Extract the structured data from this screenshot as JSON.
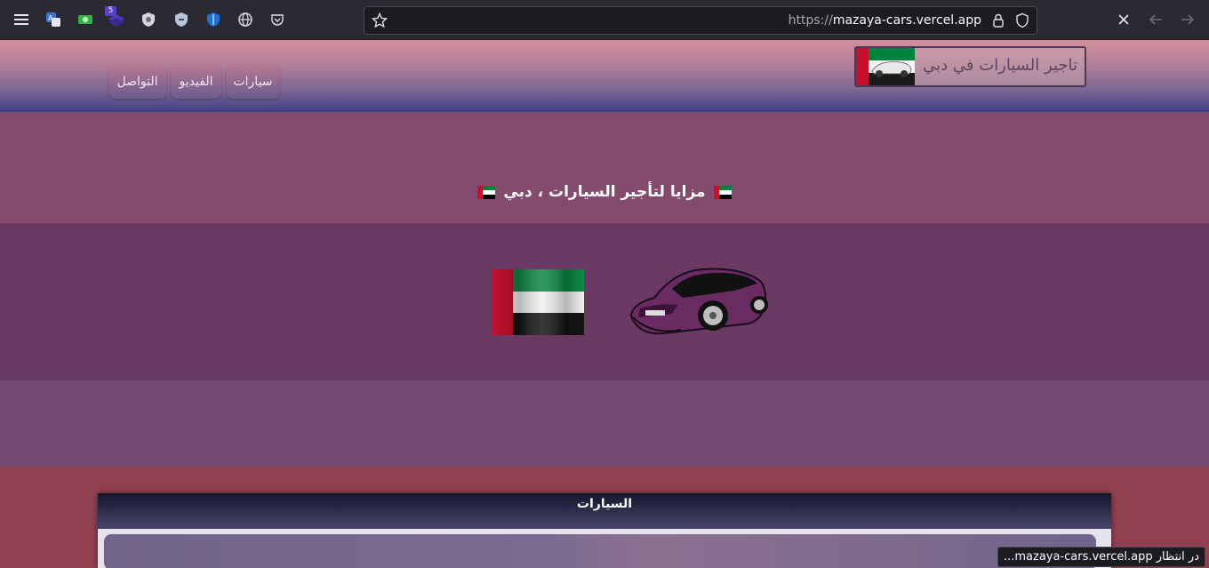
{
  "browser": {
    "url_scheme": "https://",
    "url_host": "mazaya-cars.vercel.app",
    "extension_badge": "5",
    "status_text": "در انتظار mazaya-cars.vercel.app..."
  },
  "site": {
    "brand_title": "تاجير السيارات في دبي",
    "nav": [
      "سيارات",
      "الفيديو",
      "التواصل"
    ],
    "hero_title": "مزايا لتأجير السيارات ، دبي",
    "section_title": "السيارات"
  },
  "colors": {
    "hero_bg": "#844b6e",
    "band_bg": "#6b3a64",
    "accent_red": "#914050",
    "flag_green": "#00843d",
    "flag_red": "#c8102e"
  }
}
